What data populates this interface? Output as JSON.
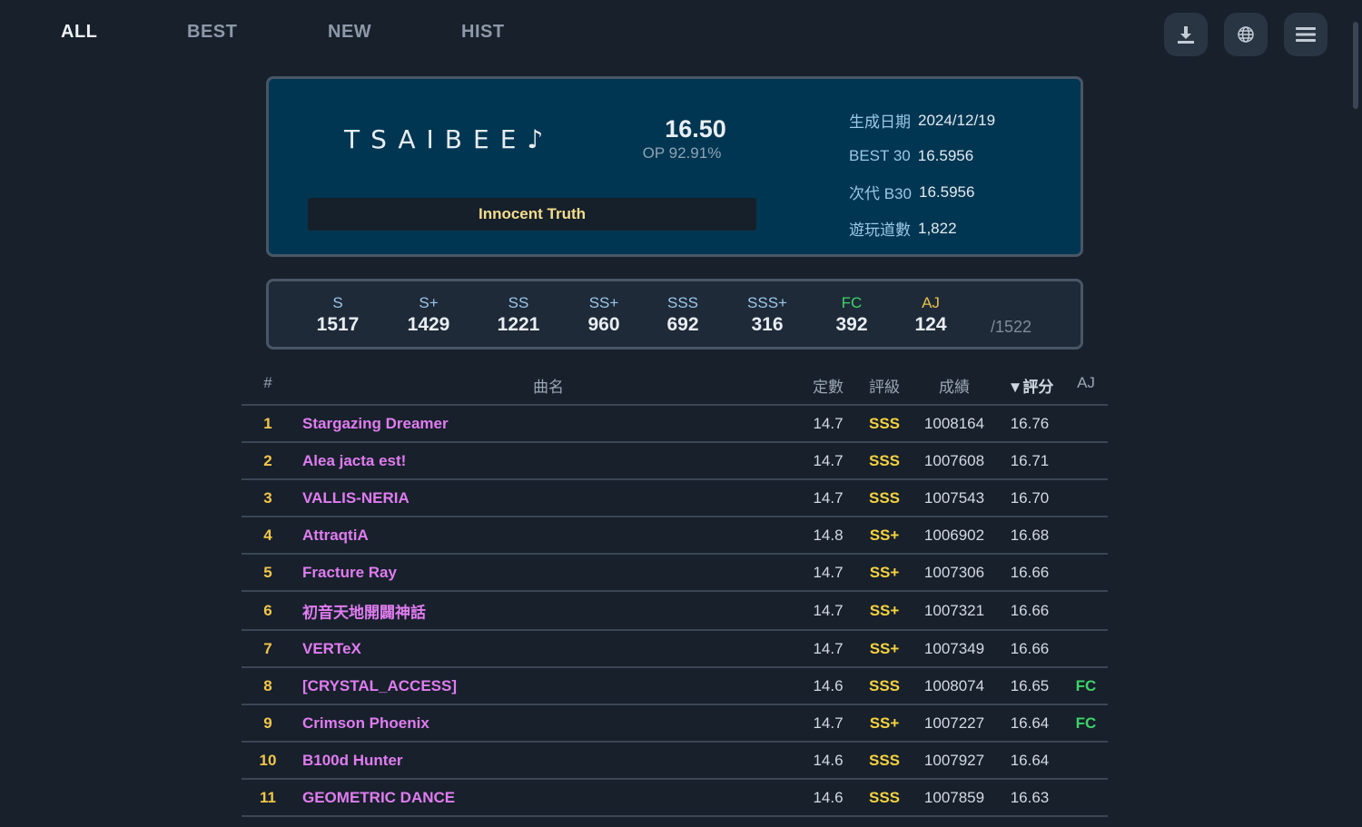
{
  "nav": {
    "tabs": [
      {
        "label": "ALL",
        "active": true
      },
      {
        "label": "BEST",
        "active": false
      },
      {
        "label": "NEW",
        "active": false
      },
      {
        "label": "HIST",
        "active": false
      }
    ],
    "icons": [
      "download-icon",
      "globe-icon",
      "menu-icon"
    ]
  },
  "profile": {
    "name": "TSAIBEE♪",
    "rating": "16.50",
    "op": "OP 92.91%",
    "honor": "Innocent Truth",
    "stats": [
      {
        "label": "生成日期",
        "value": "2024/12/19"
      },
      {
        "label": "BEST 30",
        "value": "16.5956"
      },
      {
        "label": "次代 B30",
        "value": "16.5956"
      },
      {
        "label": "遊玩道數",
        "value": "1,822"
      }
    ]
  },
  "grades": {
    "items": [
      {
        "label": "S",
        "value": "1517"
      },
      {
        "label": "S+",
        "value": "1429"
      },
      {
        "label": "SS",
        "value": "1221"
      },
      {
        "label": "SS+",
        "value": "960"
      },
      {
        "label": "SSS",
        "value": "692"
      },
      {
        "label": "SSS+",
        "value": "316"
      },
      {
        "label": "FC",
        "value": "392"
      },
      {
        "label": "AJ",
        "value": "124"
      }
    ],
    "total": "/1522"
  },
  "table": {
    "headers": {
      "idx": "#",
      "name": "曲名",
      "const": "定數",
      "grade": "評級",
      "score": "成績",
      "rating": "▼評分",
      "aj": "AJ"
    },
    "rows": [
      {
        "idx": "1",
        "name": "Stargazing Dreamer",
        "const": "14.7",
        "grade": "SSS",
        "score": "1008164",
        "rating": "16.76",
        "aj": ""
      },
      {
        "idx": "2",
        "name": "Alea jacta est!",
        "const": "14.7",
        "grade": "SSS",
        "score": "1007608",
        "rating": "16.71",
        "aj": ""
      },
      {
        "idx": "3",
        "name": "VALLIS-NERIA",
        "const": "14.7",
        "grade": "SSS",
        "score": "1007543",
        "rating": "16.70",
        "aj": ""
      },
      {
        "idx": "4",
        "name": "AttraqtiA",
        "const": "14.8",
        "grade": "SS+",
        "score": "1006902",
        "rating": "16.68",
        "aj": ""
      },
      {
        "idx": "5",
        "name": "Fracture Ray",
        "const": "14.7",
        "grade": "SS+",
        "score": "1007306",
        "rating": "16.66",
        "aj": ""
      },
      {
        "idx": "6",
        "name": "初音天地開闢神話",
        "const": "14.7",
        "grade": "SS+",
        "score": "1007321",
        "rating": "16.66",
        "aj": ""
      },
      {
        "idx": "7",
        "name": "VERTeX",
        "const": "14.7",
        "grade": "SS+",
        "score": "1007349",
        "rating": "16.66",
        "aj": ""
      },
      {
        "idx": "8",
        "name": "[CRYSTAL_ACCESS]",
        "const": "14.6",
        "grade": "SSS",
        "score": "1008074",
        "rating": "16.65",
        "aj": "FC"
      },
      {
        "idx": "9",
        "name": "Crimson Phoenix",
        "const": "14.7",
        "grade": "SS+",
        "score": "1007227",
        "rating": "16.64",
        "aj": "FC"
      },
      {
        "idx": "10",
        "name": "B100d Hunter",
        "const": "14.6",
        "grade": "SSS",
        "score": "1007927",
        "rating": "16.64",
        "aj": ""
      },
      {
        "idx": "11",
        "name": "GEOMETRIC DANCE",
        "const": "14.6",
        "grade": "SSS",
        "score": "1007859",
        "rating": "16.63",
        "aj": ""
      }
    ]
  },
  "colors": {
    "background": "#17202b",
    "card": "#003652",
    "song_name": "#e07cf0",
    "grade": "#f6d23e",
    "rank": "#f3c64a",
    "fc": "#3fd268"
  }
}
